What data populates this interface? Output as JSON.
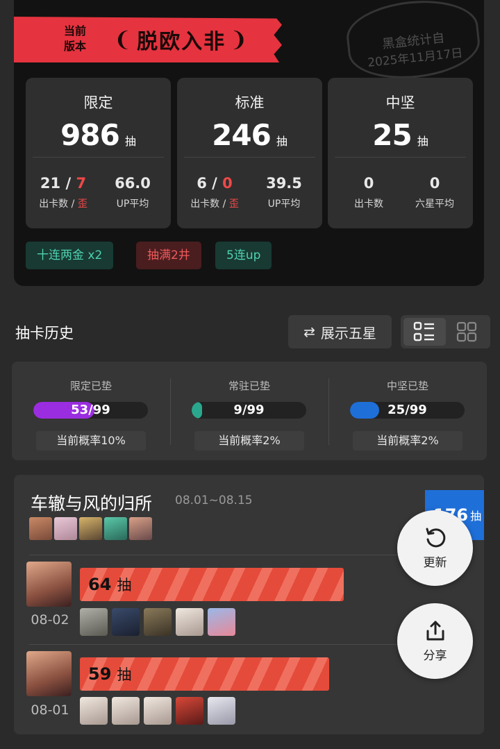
{
  "banner": {
    "version_label": "当前版本",
    "title": "脱欧入非"
  },
  "stamp": {
    "line1": "黑盒统计自",
    "line2": "2025年11月17日"
  },
  "stats": [
    {
      "name": "限定",
      "count": "986",
      "unit": "抽",
      "sub1": {
        "value_a": "21",
        "sep": " / ",
        "value_b": "7",
        "label_a": "出卡数",
        "label_sep": " / ",
        "label_b": "歪"
      },
      "sub2": {
        "value": "66.0",
        "label": "UP平均"
      }
    },
    {
      "name": "标准",
      "count": "246",
      "unit": "抽",
      "sub1": {
        "value_a": "6",
        "sep": " / ",
        "value_b": "0",
        "label_a": "出卡数",
        "label_sep": " / ",
        "label_b": "歪"
      },
      "sub2": {
        "value": "39.5",
        "label": "UP平均"
      }
    },
    {
      "name": "中坚",
      "count": "25",
      "unit": "抽",
      "sub1": {
        "value": "0",
        "label": "出卡数"
      },
      "sub2": {
        "value": "0",
        "label": "六星平均"
      }
    }
  ],
  "tags": [
    {
      "label": "十连两金  x2",
      "kind": "green"
    },
    {
      "label": "抽满2井",
      "kind": "red"
    },
    {
      "label": "5连up",
      "kind": "green"
    }
  ],
  "history": {
    "title": "抽卡历史",
    "show_five_label": "展示五星",
    "swap_icon": "⇄"
  },
  "pity": [
    {
      "label": "限定已垫",
      "text": "53/99",
      "current": 53,
      "max": 99,
      "color": "#9b2de0",
      "rate": "当前概率10%"
    },
    {
      "label": "常驻已垫",
      "text": "9/99",
      "current": 9,
      "max": 99,
      "color": "#2aa88e",
      "rate": "当前概率2%"
    },
    {
      "label": "中坚已垫",
      "text": "25/99",
      "current": 25,
      "max": 99,
      "color": "#1f6fd9",
      "rate": "当前概率2%"
    }
  ],
  "pool": {
    "title": "车辙与风的归所",
    "dates": "08.01~08.15",
    "total_num": "176",
    "total_unit": "抽",
    "pulls": [
      {
        "date": "08-02",
        "count": "64",
        "unit": "抽",
        "fill": 0.9
      },
      {
        "date": "08-01",
        "count": "59",
        "unit": "抽",
        "fill": 0.85
      }
    ]
  },
  "fab": {
    "refresh_label": "更新",
    "share_label": "分享"
  },
  "colors": {
    "accent_red": "#e5333f",
    "bar_red": "#e54b3a",
    "pool_blue": "#1f6fd9"
  }
}
